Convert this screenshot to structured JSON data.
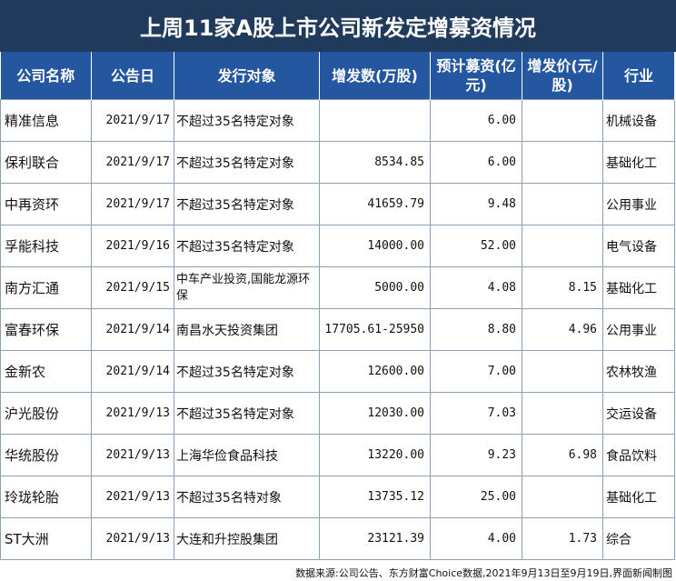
{
  "title": "上周11家A股上市公司新发定增募资情况",
  "headers": {
    "company": "公司名称",
    "date": "公告日",
    "target": "发行对象",
    "shares": "增发数(万股)",
    "funds": "预计募资(亿元)",
    "price": "增发价(元/股)",
    "industry": "行业"
  },
  "rows": [
    {
      "company": "精准信息",
      "date": "2021/9/17",
      "target": "不超过35名特定对象",
      "shares": "",
      "funds": "6.00",
      "price": "",
      "industry": "机械设备"
    },
    {
      "company": "保利联合",
      "date": "2021/9/17",
      "target": "不超过35名特定对象",
      "shares": "8534.85",
      "funds": "6.00",
      "price": "",
      "industry": "基础化工"
    },
    {
      "company": "中再资环",
      "date": "2021/9/17",
      "target": "不超过35名特定对象",
      "shares": "41659.79",
      "funds": "9.48",
      "price": "",
      "industry": "公用事业"
    },
    {
      "company": "孚能科技",
      "date": "2021/9/16",
      "target": "不超过35名特定对象",
      "shares": "14000.00",
      "funds": "52.00",
      "price": "",
      "industry": "电气设备"
    },
    {
      "company": "南方汇通",
      "date": "2021/9/15",
      "target": "中车产业投资,国能龙源环保",
      "shares": "5000.00",
      "funds": "4.08",
      "price": "8.15",
      "industry": "基础化工"
    },
    {
      "company": "富春环保",
      "date": "2021/9/14",
      "target": "南昌水天投资集团",
      "shares": "17705.61-25950",
      "funds": "8.80",
      "price": "4.96",
      "industry": "公用事业"
    },
    {
      "company": "金新农",
      "date": "2021/9/14",
      "target": "不超过35名特定对象",
      "shares": "12600.00",
      "funds": "7.00",
      "price": "",
      "industry": "农林牧渔"
    },
    {
      "company": "沪光股份",
      "date": "2021/9/13",
      "target": "不超过35名特定对象",
      "shares": "12030.00",
      "funds": "7.03",
      "price": "",
      "industry": "交运设备"
    },
    {
      "company": "华统股份",
      "date": "2021/9/13",
      "target": "上海华俭食品科技",
      "shares": "13220.00",
      "funds": "9.23",
      "price": "6.98",
      "industry": "食品饮料"
    },
    {
      "company": "玲珑轮胎",
      "date": "2021/9/13",
      "target": "不超过35名特对象",
      "shares": "13735.12",
      "funds": "25.00",
      "price": "",
      "industry": "基础化工"
    },
    {
      "company": "ST大洲",
      "date": "2021/9/13",
      "target": "大连和升控股集团",
      "shares": "23121.39",
      "funds": "4.00",
      "price": "1.73",
      "industry": "综合"
    }
  ],
  "footer": "数据来源:公司公告、东方财富Choice数据,2021年9月13日至9月19日,界面新闻制图",
  "colors": {
    "title_bg": "#1f3a5a",
    "header_bg": "#2457a0",
    "header_text": "#ffffff",
    "grid": "#8aa0b8"
  }
}
